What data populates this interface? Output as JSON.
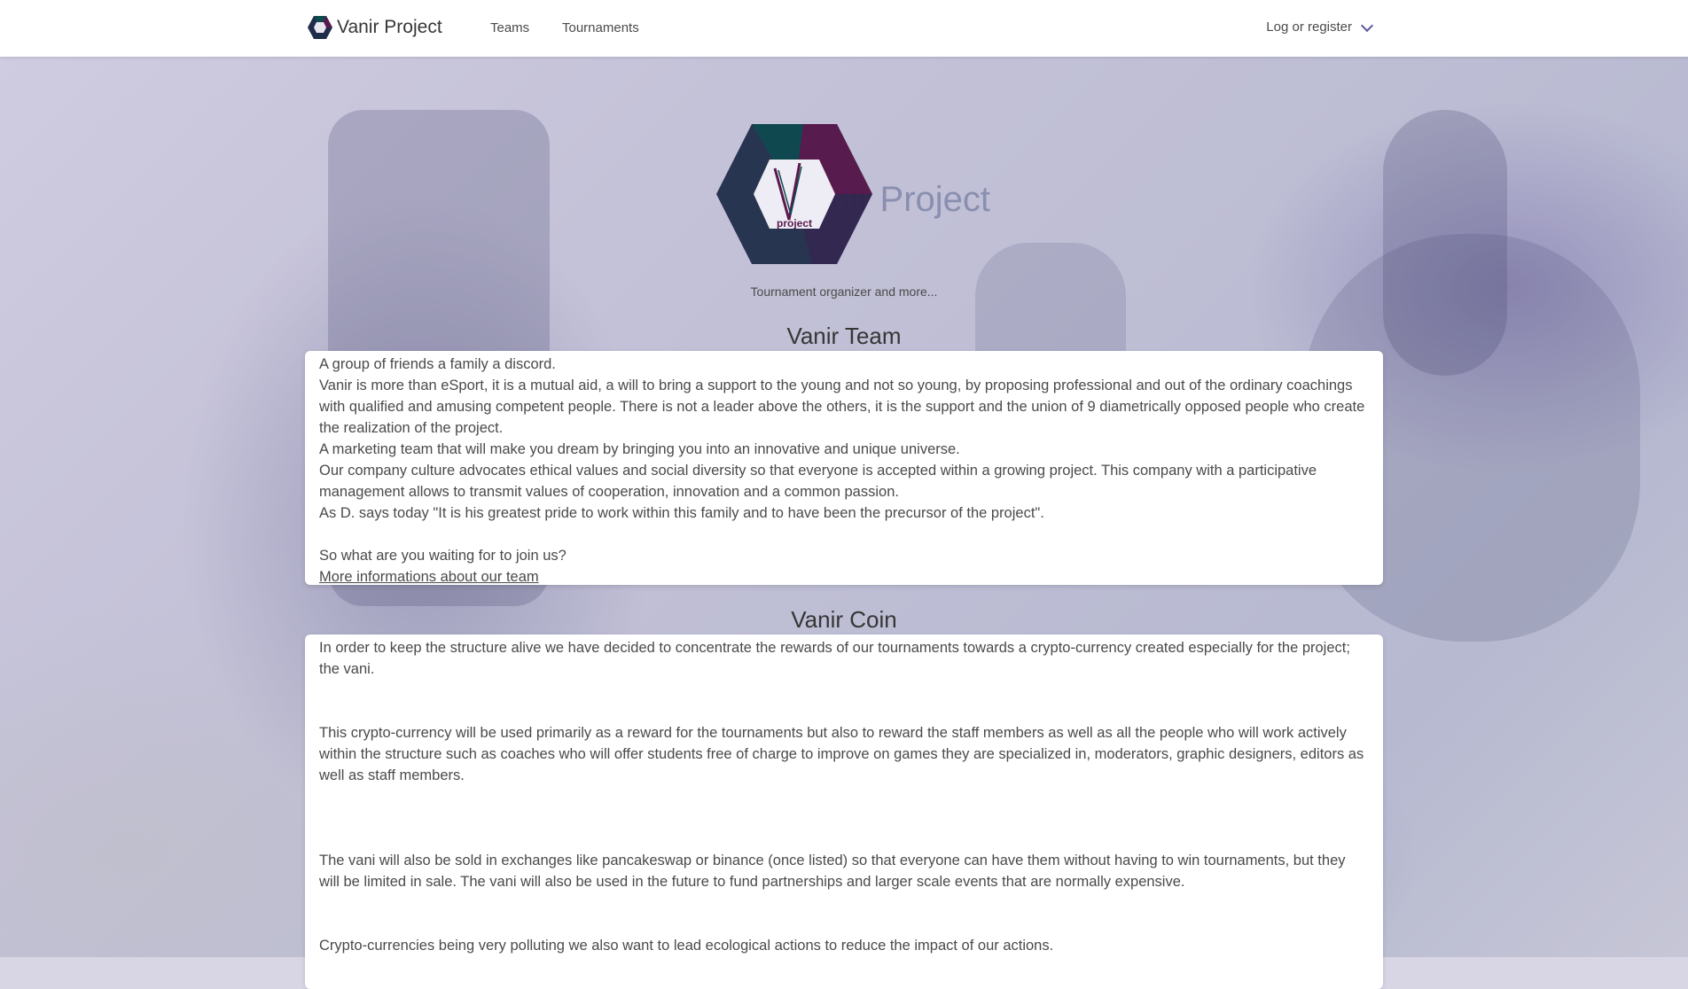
{
  "navbar": {
    "brand": "Vanir Project",
    "links": [
      "Teams",
      "Tournaments"
    ],
    "login": "Log or register"
  },
  "hero": {
    "title": "Vanir Project",
    "logo_text": "project",
    "subtitle": "Tournament organizer and more..."
  },
  "team": {
    "title": "Vanir Team",
    "paragraphs": [
      "A group of friends a family a discord.",
      "Vanir is more than eSport, it is a mutual aid, a will to bring a support to the young and not so young, by proposing professional and out of the ordinary coachings with qualified and amusing competent people. There is not a leader above the others, it is the support and the union of 9 diametrically opposed people who create the realization of the project.",
      "A marketing team that will make you dream by bringing you into an innovative and unique universe.",
      "Our company culture advocates ethical values and social diversity so that everyone is accepted within a growing project. This company with a participative management allows to transmit values of cooperation, innovation and a common passion.",
      "As D. says today \"It is his greatest pride to work within this family and to have been the precursor of the project\".",
      "So what are you waiting for to join us?"
    ],
    "link": "More informations about our team"
  },
  "coin": {
    "title": "Vanir Coin",
    "paragraphs": [
      "In order to keep the structure alive we have decided to concentrate the rewards of our tournaments towards a crypto-currency created especially for the project; the vani.",
      "This crypto-currency will be used primarily as a reward for the tournaments but also to reward the staff members as well as all the people who will work actively within the structure such as coaches who will offer students free of charge to improve on games they are specialized in, moderators, graphic designers, editors as well as staff members.",
      "The vani will also be sold in exchanges like pancakeswap or binance (once listed) so that everyone can have them without having to win tournaments, but they will be limited in sale. The vani will also be used in the future to fund partnerships and larger scale events that are normally expensive.",
      "Crypto-currencies being very polluting we also want to lead ecological actions to reduce the impact of our actions."
    ]
  },
  "colors": {
    "logo_teal": "#0f4a4f",
    "logo_purple": "#5a1a4e",
    "logo_navy": "#1f2d4a"
  }
}
